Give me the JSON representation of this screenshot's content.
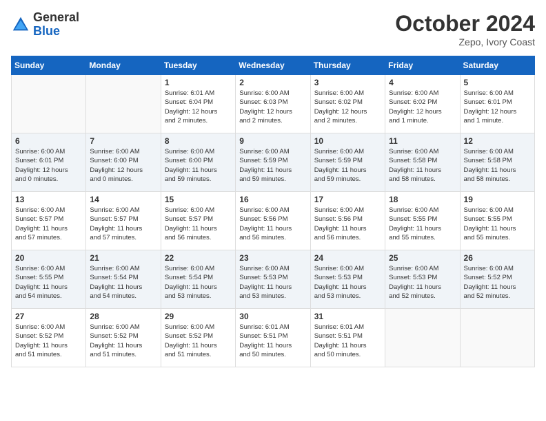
{
  "header": {
    "logo_general": "General",
    "logo_blue": "Blue",
    "month": "October 2024",
    "location": "Zepo, Ivory Coast"
  },
  "days_of_week": [
    "Sunday",
    "Monday",
    "Tuesday",
    "Wednesday",
    "Thursday",
    "Friday",
    "Saturday"
  ],
  "weeks": [
    [
      {
        "day": "",
        "info": ""
      },
      {
        "day": "",
        "info": ""
      },
      {
        "day": "1",
        "info": "Sunrise: 6:01 AM\nSunset: 6:04 PM\nDaylight: 12 hours\nand 2 minutes."
      },
      {
        "day": "2",
        "info": "Sunrise: 6:00 AM\nSunset: 6:03 PM\nDaylight: 12 hours\nand 2 minutes."
      },
      {
        "day": "3",
        "info": "Sunrise: 6:00 AM\nSunset: 6:02 PM\nDaylight: 12 hours\nand 2 minutes."
      },
      {
        "day": "4",
        "info": "Sunrise: 6:00 AM\nSunset: 6:02 PM\nDaylight: 12 hours\nand 1 minute."
      },
      {
        "day": "5",
        "info": "Sunrise: 6:00 AM\nSunset: 6:01 PM\nDaylight: 12 hours\nand 1 minute."
      }
    ],
    [
      {
        "day": "6",
        "info": "Sunrise: 6:00 AM\nSunset: 6:01 PM\nDaylight: 12 hours\nand 0 minutes."
      },
      {
        "day": "7",
        "info": "Sunrise: 6:00 AM\nSunset: 6:00 PM\nDaylight: 12 hours\nand 0 minutes."
      },
      {
        "day": "8",
        "info": "Sunrise: 6:00 AM\nSunset: 6:00 PM\nDaylight: 11 hours\nand 59 minutes."
      },
      {
        "day": "9",
        "info": "Sunrise: 6:00 AM\nSunset: 5:59 PM\nDaylight: 11 hours\nand 59 minutes."
      },
      {
        "day": "10",
        "info": "Sunrise: 6:00 AM\nSunset: 5:59 PM\nDaylight: 11 hours\nand 59 minutes."
      },
      {
        "day": "11",
        "info": "Sunrise: 6:00 AM\nSunset: 5:58 PM\nDaylight: 11 hours\nand 58 minutes."
      },
      {
        "day": "12",
        "info": "Sunrise: 6:00 AM\nSunset: 5:58 PM\nDaylight: 11 hours\nand 58 minutes."
      }
    ],
    [
      {
        "day": "13",
        "info": "Sunrise: 6:00 AM\nSunset: 5:57 PM\nDaylight: 11 hours\nand 57 minutes."
      },
      {
        "day": "14",
        "info": "Sunrise: 6:00 AM\nSunset: 5:57 PM\nDaylight: 11 hours\nand 57 minutes."
      },
      {
        "day": "15",
        "info": "Sunrise: 6:00 AM\nSunset: 5:57 PM\nDaylight: 11 hours\nand 56 minutes."
      },
      {
        "day": "16",
        "info": "Sunrise: 6:00 AM\nSunset: 5:56 PM\nDaylight: 11 hours\nand 56 minutes."
      },
      {
        "day": "17",
        "info": "Sunrise: 6:00 AM\nSunset: 5:56 PM\nDaylight: 11 hours\nand 56 minutes."
      },
      {
        "day": "18",
        "info": "Sunrise: 6:00 AM\nSunset: 5:55 PM\nDaylight: 11 hours\nand 55 minutes."
      },
      {
        "day": "19",
        "info": "Sunrise: 6:00 AM\nSunset: 5:55 PM\nDaylight: 11 hours\nand 55 minutes."
      }
    ],
    [
      {
        "day": "20",
        "info": "Sunrise: 6:00 AM\nSunset: 5:55 PM\nDaylight: 11 hours\nand 54 minutes."
      },
      {
        "day": "21",
        "info": "Sunrise: 6:00 AM\nSunset: 5:54 PM\nDaylight: 11 hours\nand 54 minutes."
      },
      {
        "day": "22",
        "info": "Sunrise: 6:00 AM\nSunset: 5:54 PM\nDaylight: 11 hours\nand 53 minutes."
      },
      {
        "day": "23",
        "info": "Sunrise: 6:00 AM\nSunset: 5:53 PM\nDaylight: 11 hours\nand 53 minutes."
      },
      {
        "day": "24",
        "info": "Sunrise: 6:00 AM\nSunset: 5:53 PM\nDaylight: 11 hours\nand 53 minutes."
      },
      {
        "day": "25",
        "info": "Sunrise: 6:00 AM\nSunset: 5:53 PM\nDaylight: 11 hours\nand 52 minutes."
      },
      {
        "day": "26",
        "info": "Sunrise: 6:00 AM\nSunset: 5:52 PM\nDaylight: 11 hours\nand 52 minutes."
      }
    ],
    [
      {
        "day": "27",
        "info": "Sunrise: 6:00 AM\nSunset: 5:52 PM\nDaylight: 11 hours\nand 51 minutes."
      },
      {
        "day": "28",
        "info": "Sunrise: 6:00 AM\nSunset: 5:52 PM\nDaylight: 11 hours\nand 51 minutes."
      },
      {
        "day": "29",
        "info": "Sunrise: 6:00 AM\nSunset: 5:52 PM\nDaylight: 11 hours\nand 51 minutes."
      },
      {
        "day": "30",
        "info": "Sunrise: 6:01 AM\nSunset: 5:51 PM\nDaylight: 11 hours\nand 50 minutes."
      },
      {
        "day": "31",
        "info": "Sunrise: 6:01 AM\nSunset: 5:51 PM\nDaylight: 11 hours\nand 50 minutes."
      },
      {
        "day": "",
        "info": ""
      },
      {
        "day": "",
        "info": ""
      }
    ]
  ]
}
